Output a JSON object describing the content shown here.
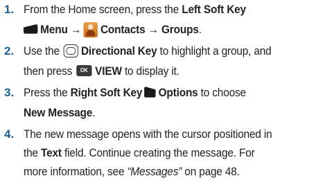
{
  "steps": [
    {
      "num": "1.",
      "l1_a": "From the Home screen, press the ",
      "l1_b": "Left Soft Key",
      "l2_menu": "Menu →",
      "l2_contacts": "Contacts → Groups",
      "l2_end": "."
    },
    {
      "num": "2.",
      "l1_a": "Use the ",
      "l1_b": "Directional Key",
      "l1_c": " to highlight a group, and",
      "l2_a": "then press ",
      "ok_label": "OK",
      "l2_b": "VIEW",
      "l2_c": " to display it."
    },
    {
      "num": "3.",
      "l1_a": "Press the ",
      "l1_b": "Right Soft Key",
      "l1_c": "Options",
      "l1_d": " to choose",
      "l2_a": "New Message",
      "l2_b": "."
    },
    {
      "num": "4.",
      "l1": "The new message opens with the cursor positioned in",
      "l2_a": "the ",
      "l2_b": "Text",
      "l2_c": " field. Continue creating the message. For",
      "l3_a": "more information, see ",
      "l3_link": "“Messages”",
      "l3_b": " on page 48."
    }
  ],
  "icons": {
    "left_soft_key": "left-soft-key-icon",
    "contacts": "contacts-icon",
    "directional_key": "directional-key-icon",
    "ok_key": "ok-key-icon",
    "right_soft_key": "right-soft-key-icon"
  },
  "colors": {
    "step_number": "#1a5f99",
    "text": "#222222"
  }
}
